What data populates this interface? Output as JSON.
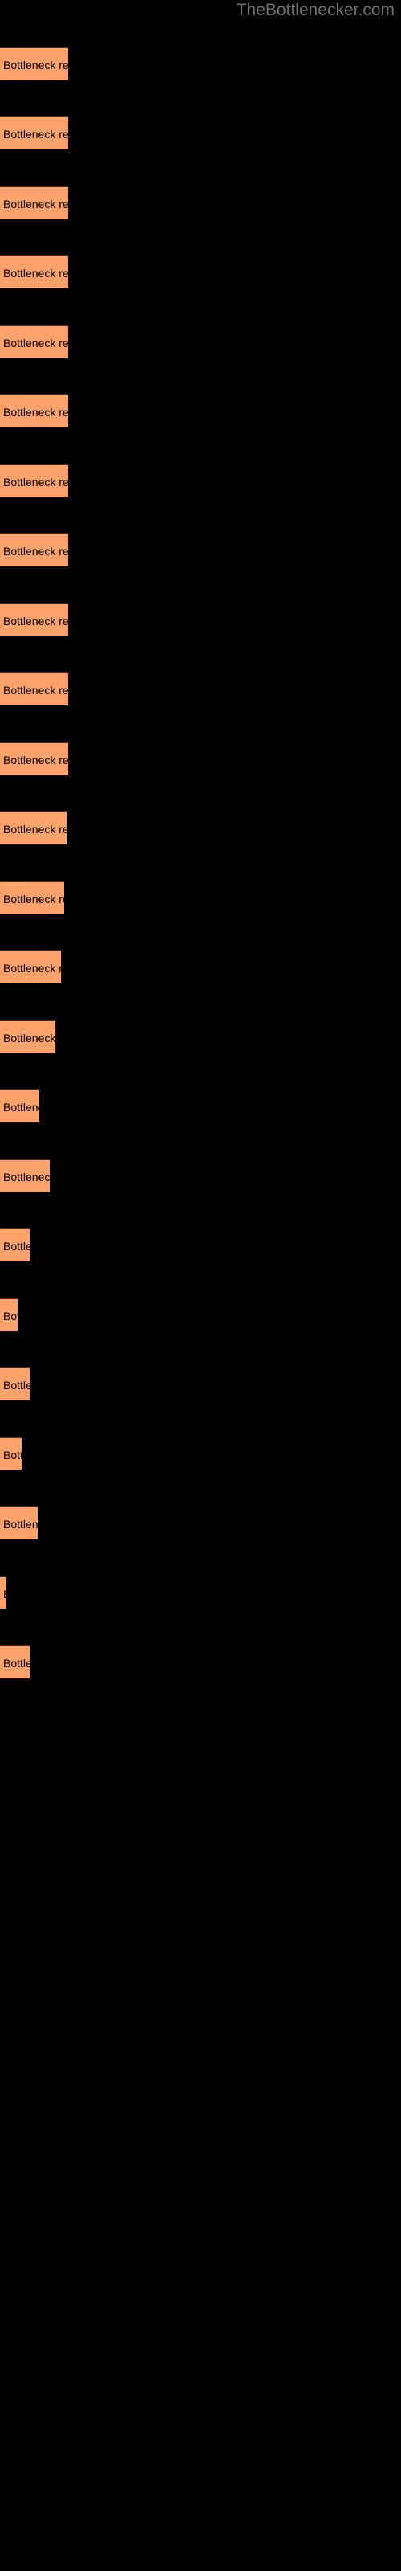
{
  "watermark": "TheBottlenecker.com",
  "background_color": "#000000",
  "bar_color": "#fca26a",
  "label_color": "#000000",
  "watermark_color": "#6e6e6e",
  "chart_data": {
    "type": "bar",
    "orientation": "horizontal",
    "title": "",
    "subtitle": "",
    "xlabel": "",
    "ylabel": "",
    "grid": false,
    "legend": null,
    "categories": [
      "Bottleneck result",
      "Bottleneck result",
      "Bottleneck result",
      "Bottleneck result",
      "Bottleneck result",
      "Bottleneck result",
      "Bottleneck result",
      "Bottleneck result",
      "Bottleneck result",
      "Bottleneck result",
      "Bottleneck result",
      "Bottleneck result",
      "Bottleneck result",
      "Bottleneck result",
      "Bottleneck result",
      "Bottleneck result",
      "Bottleneck result",
      "Bottleneck result",
      "Bottleneck result",
      "Bottleneck result",
      "Bottleneck result",
      "Bottleneck result",
      "Bottleneck result"
    ],
    "values": [
      85,
      85,
      85,
      85,
      85,
      85,
      85,
      85,
      85,
      85,
      85,
      83,
      80,
      76,
      69,
      62,
      55,
      48,
      40,
      33,
      26,
      20,
      12
    ],
    "xlim": [
      0,
      500
    ],
    "ylim": [
      0,
      23
    ]
  },
  "bars": [
    {
      "label": "Bottleneck result",
      "width": 85,
      "top": 59,
      "visible_text": "Bottleneck result"
    },
    {
      "label": "Bottleneck result",
      "width": 85,
      "top": 145,
      "visible_text": "Bottleneck result"
    },
    {
      "label": "Bottleneck result",
      "width": 85,
      "top": 232,
      "visible_text": "Bottleneck result"
    },
    {
      "label": "Bottleneck result",
      "width": 85,
      "top": 318,
      "visible_text": "Bottleneck result"
    },
    {
      "label": "Bottleneck result",
      "width": 85,
      "top": 405,
      "visible_text": "Bottleneck result"
    },
    {
      "label": "Bottleneck result",
      "width": 85,
      "top": 491,
      "visible_text": "Bottleneck result"
    },
    {
      "label": "Bottleneck result",
      "width": 85,
      "top": 578,
      "visible_text": "Bottleneck result"
    },
    {
      "label": "Bottleneck result",
      "width": 85,
      "top": 664,
      "visible_text": "Bottleneck result"
    },
    {
      "label": "Bottleneck result",
      "width": 85,
      "top": 751,
      "visible_text": "Bottleneck result"
    },
    {
      "label": "Bottleneck result",
      "width": 85,
      "top": 837,
      "visible_text": "Bottleneck result"
    },
    {
      "label": "Bottleneck result",
      "width": 85,
      "top": 924,
      "visible_text": "Bottleneck result"
    },
    {
      "label": "Bottleneck result",
      "width": 83,
      "top": 1010,
      "visible_text": "Bottleneck resu"
    },
    {
      "label": "Bottleneck result",
      "width": 80,
      "top": 1097,
      "visible_text": "Bottleneck resu"
    },
    {
      "label": "Bottleneck result",
      "width": 76,
      "top": 1183,
      "visible_text": "Bottleneck resu"
    },
    {
      "label": "Bottleneck result",
      "width": 69,
      "top": 1270,
      "visible_text": "Bottleneck"
    },
    {
      "label": "Bottleneck result",
      "width": 62,
      "top": 1356,
      "visible_text": "Bottlen"
    },
    {
      "label": "Bottleneck result",
      "width": 55,
      "top": 1443,
      "visible_text": "Bottlenec"
    },
    {
      "label": "Bottleneck result",
      "width": 48,
      "top": 1529,
      "visible_text": "Bottl"
    },
    {
      "label": "Bottleneck result",
      "width": 40,
      "top": 1616,
      "visible_text": "B"
    },
    {
      "label": "Bottleneck result",
      "width": 33,
      "top": 1702,
      "visible_text": "Bottl"
    },
    {
      "label": "Bottleneck result",
      "width": 26,
      "top": 1789,
      "visible_text": "Bot"
    },
    {
      "label": "Bottleneck result",
      "width": 20,
      "top": 1875,
      "visible_text": "Bottlen"
    },
    {
      "label": "Bottleneck result",
      "width": 12,
      "top": 1962,
      "visible_text": ""
    },
    {
      "label": "Bottleneck result",
      "width": 12,
      "top": 2048,
      "visible_text": "Bott"
    }
  ]
}
